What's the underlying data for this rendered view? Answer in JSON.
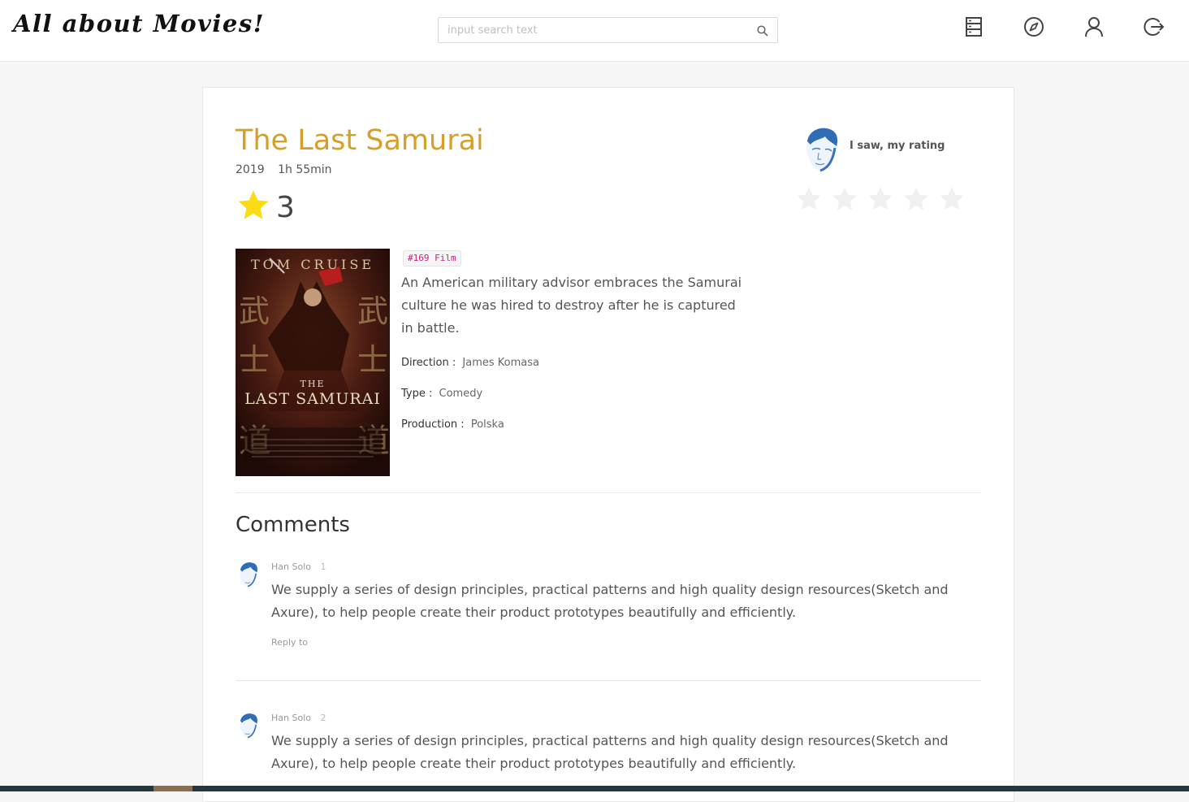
{
  "header": {
    "logo": "All about Movies!",
    "search_placeholder": "input search text",
    "search_value": "",
    "nav_icons": [
      "list-icon",
      "compass-icon",
      "user-icon",
      "logout-icon"
    ]
  },
  "movie": {
    "title": "The Last Samurai",
    "year": "2019",
    "duration": "1h 55min",
    "rating": "3",
    "tag": "#169 Film",
    "synopsis": "An American military advisor embraces the Samurai culture he was hired to destroy after he is captured in battle.",
    "details": [
      {
        "label": "Direction :",
        "value": "James Komasa"
      },
      {
        "label": "Type :",
        "value": "Comedy"
      },
      {
        "label": "Production :",
        "value": "Polska"
      }
    ],
    "poster": {
      "actor": "TOM CRUISE",
      "title_small": "THE",
      "title_big": "LAST SAMURAI"
    }
  },
  "user_rating": {
    "label": "I saw, my rating",
    "stars_total": 5,
    "stars_selected": 0
  },
  "comments": {
    "heading": "Comments",
    "items": [
      {
        "author": "Han Solo",
        "index": "1",
        "body": "We supply a series of design principles, practical patterns and high quality design resources(Sketch and Axure), to help people create their product prototypes beautifully and efficiently.",
        "reply_label": "Reply to"
      },
      {
        "author": "Han Solo",
        "index": "2",
        "body": "We supply a series of design principles, practical patterns and high quality design resources(Sketch and Axure), to help people create their product prototypes beautifully and efficiently."
      }
    ]
  },
  "colors": {
    "title": "#d59f29",
    "rating_star": "#fadb14",
    "empty_star": "#f0f0f0",
    "tag_text": "#c41d7f"
  }
}
